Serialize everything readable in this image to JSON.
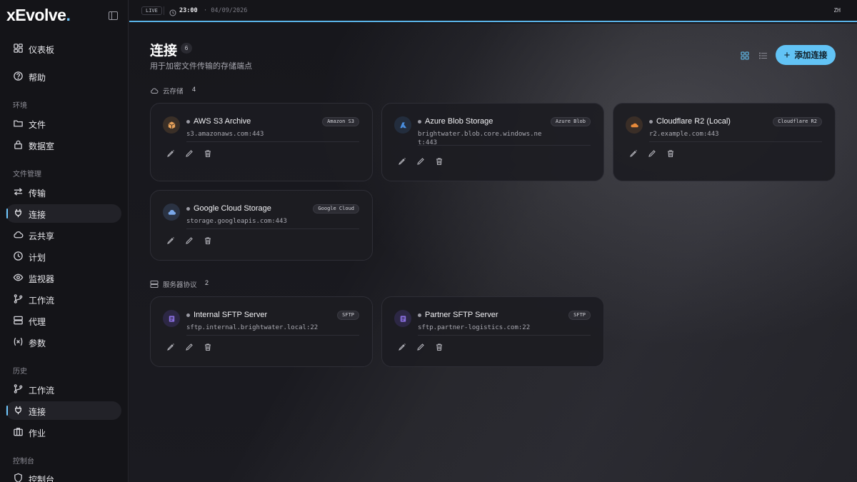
{
  "brand": {
    "name": "xEvolve",
    "dot": "."
  },
  "colors": {
    "accent": "#62c3f5",
    "background": "#16161b",
    "sidebar": "#141418"
  },
  "topbar": {
    "live": "LIVE",
    "time": "23:00",
    "date": "· 04/09/2026",
    "lang": "ZH"
  },
  "sidebar": {
    "dashboard": {
      "label": "仪表板",
      "icon": "dashboard-icon"
    },
    "help": {
      "label": "帮助",
      "icon": "help-icon"
    },
    "sections": {
      "env": "环境",
      "file_mgmt": "文件管理",
      "history": "历史",
      "console": "控制台"
    },
    "files": {
      "label": "文件",
      "icon": "folder-icon"
    },
    "vault": {
      "label": "数据室",
      "icon": "lock-icon"
    },
    "transfer": {
      "label": "传输",
      "icon": "transfer-icon"
    },
    "connections": {
      "label": "连接",
      "icon": "plug-icon",
      "active": true
    },
    "cloud_share": {
      "label": "云共享",
      "icon": "cloud-icon"
    },
    "schedule": {
      "label": "计划",
      "icon": "clock-icon"
    },
    "monitor": {
      "label": "监视器",
      "icon": "eye-icon"
    },
    "workflow": {
      "label": "工作流",
      "icon": "workflow-icon"
    },
    "proxy": {
      "label": "代理",
      "icon": "server-icon"
    },
    "params": {
      "label": "参数",
      "icon": "variable-icon"
    },
    "hist_workflow": {
      "label": "工作流",
      "icon": "workflow-icon"
    },
    "hist_connections": {
      "label": "连接",
      "icon": "plug-icon",
      "active": true
    },
    "jobs": {
      "label": "作业",
      "icon": "briefcase-icon"
    },
    "console": {
      "label": "控制台",
      "icon": "shield-icon"
    }
  },
  "main": {
    "title": "连接",
    "count": "6",
    "subtitle": "用于加密文件传输的存储端点",
    "add_button": "添加连接",
    "groups": {
      "cloud": {
        "label": "云存储",
        "count": "4"
      },
      "server": {
        "label": "服务器协议",
        "count": "2"
      }
    },
    "cards": [
      {
        "name": "AWS S3 Archive",
        "tag": "Amazon S3",
        "host": "s3.amazonaws.com:443",
        "icon": "aws-icon",
        "icon_color": "#e8a25a"
      },
      {
        "name": "Azure Blob Storage",
        "tag": "Azure Blob",
        "host": "brightwater.blob.core.windows.net:443",
        "icon": "azure-icon",
        "icon_color": "#4a8fe0"
      },
      {
        "name": "Cloudflare R2 (Local)",
        "tag": "Cloudflare R2",
        "host": "r2.example.com:443",
        "icon": "cloudflare-icon",
        "icon_color": "#e88a3a"
      },
      {
        "name": "Google Cloud Storage",
        "tag": "Google Cloud",
        "host": "storage.googleapis.com:443",
        "icon": "gcloud-icon",
        "icon_color": "#7aa7e8"
      },
      {
        "name": "Internal SFTP Server",
        "tag": "SFTP",
        "host": "sftp.internal.brightwater.local:22",
        "icon": "sftp-icon",
        "icon_color": "#8a6fe0"
      },
      {
        "name": "Partner SFTP Server",
        "tag": "SFTP",
        "host": "sftp.partner-logistics.com:22",
        "icon": "sftp-icon",
        "icon_color": "#8a6fe0"
      }
    ]
  }
}
